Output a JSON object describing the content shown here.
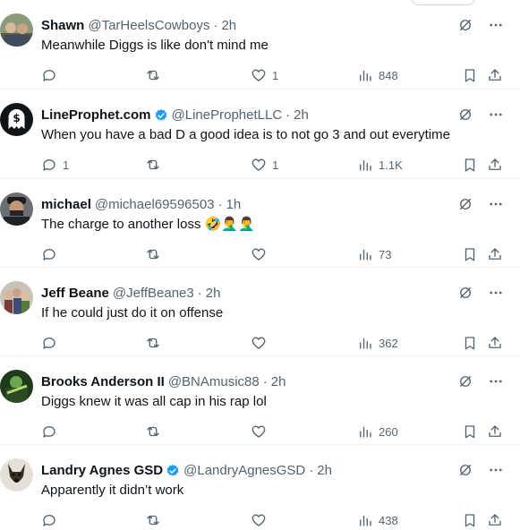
{
  "tweets": [
    {
      "name": "Shawn",
      "handle": "@TarHeelsCowboys",
      "time": "2h",
      "verified": false,
      "text": "Meanwhile Diggs is like don't mind me",
      "replies": "",
      "retweets": "",
      "likes": "1",
      "views": "848",
      "avatar": "avatar-shawn"
    },
    {
      "name": "LineProphet.com",
      "handle": "@LineProphetLLC",
      "time": "2h",
      "verified": true,
      "text": "When you have a bad D a good idea is to not go 3 and out everytime",
      "replies": "1",
      "retweets": "",
      "likes": "1",
      "views": "1.1K",
      "avatar": "avatar-lineprophet"
    },
    {
      "name": "michael",
      "handle": "@michael69596503",
      "time": "1h",
      "verified": false,
      "text": "The charge to another loss 🤣🤦‍♂️🤦‍♂️",
      "replies": "",
      "retweets": "",
      "likes": "",
      "views": "73",
      "avatar": "avatar-michael"
    },
    {
      "name": "Jeff Beane",
      "handle": "@JeffBeane3",
      "time": "2h",
      "verified": false,
      "text": "If he could just do it on offense",
      "replies": "",
      "retweets": "",
      "likes": "",
      "views": "362",
      "avatar": "avatar-jeff"
    },
    {
      "name": "Brooks Anderson II",
      "handle": "@BNAmusic88",
      "time": "2h",
      "verified": false,
      "text": "Diggs knew it was all cap in his rap lol",
      "replies": "",
      "retweets": "",
      "likes": "",
      "views": "260",
      "avatar": "avatar-brooks"
    },
    {
      "name": "Landry Agnes GSD",
      "handle": "@LandryAgnesGSD",
      "time": "2h",
      "verified": true,
      "text": "Apparently it didn’t work",
      "replies": "",
      "retweets": "",
      "likes": "",
      "views": "438",
      "avatar": "avatar-landry"
    }
  ],
  "colors": {
    "text": "#0f1419",
    "muted": "#536471",
    "verified": "#1d9bf0",
    "divider": "#eff3f4"
  },
  "icons": {
    "reply": "reply-icon",
    "retweet": "retweet-icon",
    "like": "heart-icon",
    "views": "views-icon",
    "bookmark": "bookmark-icon",
    "share": "share-icon",
    "grok": "grok-icon",
    "more": "more-icon"
  }
}
